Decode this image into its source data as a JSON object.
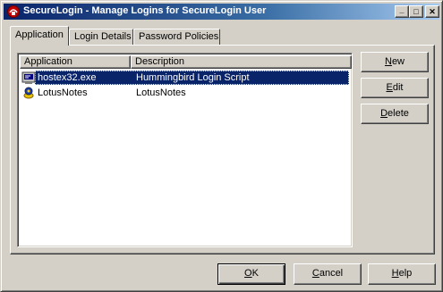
{
  "window": {
    "title": "SecureLogin - Manage Logins for SecureLogin User",
    "controls": {
      "minimize": "_",
      "maximize": "□",
      "close": "✕"
    }
  },
  "tabs": [
    {
      "label": "Application",
      "active": true
    },
    {
      "label": "Login Details",
      "active": false
    },
    {
      "label": "Password Policies",
      "active": false
    }
  ],
  "list": {
    "columns": [
      "Application",
      "Description"
    ],
    "rows": [
      {
        "application": "hostex32.exe",
        "description": "Hummingbird Login Script",
        "icon": "terminal-app-icon",
        "selected": true
      },
      {
        "application": "LotusNotes",
        "description": "LotusNotes",
        "icon": "lotus-notes-icon",
        "selected": false
      }
    ]
  },
  "side_buttons": [
    {
      "label": "New",
      "mnemonic": "N"
    },
    {
      "label": "Edit",
      "mnemonic": "E"
    },
    {
      "label": "Delete",
      "mnemonic": "D"
    }
  ],
  "bottom_buttons": [
    {
      "label": "OK",
      "mnemonic": "O"
    },
    {
      "label": "Cancel",
      "mnemonic": "C"
    },
    {
      "label": "Help",
      "mnemonic": "H"
    }
  ],
  "colors": {
    "selection": "#0a246a",
    "titlebar_start": "#0a246a",
    "titlebar_end": "#a6caf0",
    "face": "#d4d0c8"
  }
}
